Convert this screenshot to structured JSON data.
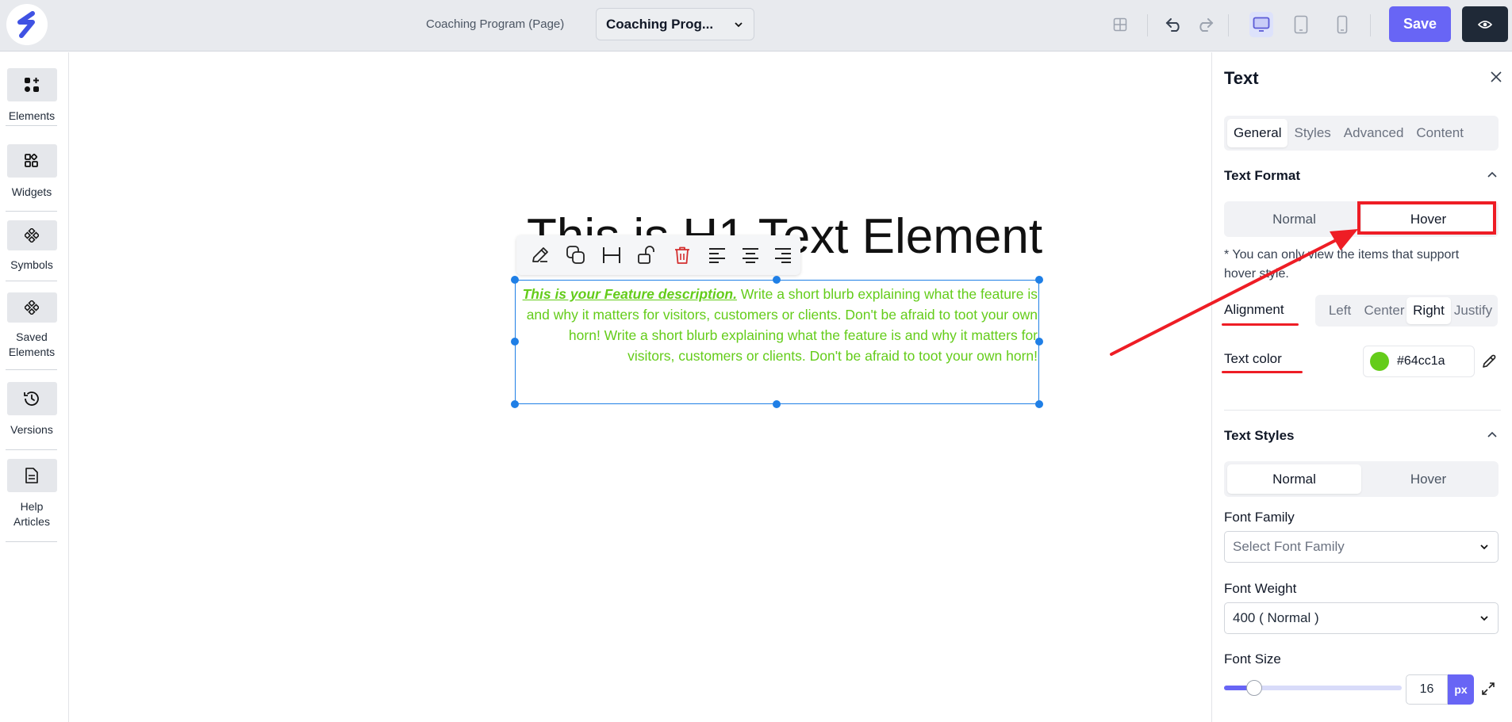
{
  "header": {
    "page_label": "Coaching Program (Page)",
    "page_select_value": "Coaching Prog...",
    "save_label": "Save"
  },
  "sidebar": {
    "items": [
      {
        "label": "Elements",
        "icon": "elements-icon"
      },
      {
        "label": "Widgets",
        "icon": "widgets-icon"
      },
      {
        "label": "Symbols",
        "icon": "symbols-icon"
      },
      {
        "label": "Saved Elements",
        "icon": "saved-elements-icon"
      },
      {
        "label": "Versions",
        "icon": "history-icon"
      },
      {
        "label": "Help Articles",
        "icon": "document-icon"
      }
    ]
  },
  "canvas": {
    "heading": "This is H1 Text Element",
    "paragraph_emphasis": "This is your Feature description.",
    "paragraph_body": " Write a short blurb explaining what the feature is and why it matters for visitors, customers or clients. Don't be afraid to toot your own horn! Write a short blurb explaining what the feature is and why it matters for visitors, customers or clients. Don't be afraid to toot your own horn!"
  },
  "panel": {
    "title": "Text",
    "tabs": [
      "General",
      "Styles",
      "Advanced",
      "Content"
    ],
    "active_tab": "General",
    "text_format": {
      "title": "Text Format",
      "modes": [
        "Normal",
        "Hover"
      ],
      "active_mode": "Hover",
      "note": "* You can only view the items that support hover style.",
      "alignment_label": "Alignment",
      "alignment_options": [
        "Left",
        "Center",
        "Right",
        "Justify"
      ],
      "active_alignment": "Right",
      "text_color_label": "Text color",
      "text_color_value": "#64cc1a"
    },
    "text_styles": {
      "title": "Text Styles",
      "modes": [
        "Normal",
        "Hover"
      ],
      "active_mode": "Normal",
      "font_family_label": "Font Family",
      "font_family_placeholder": "Select Font Family",
      "font_weight_label": "Font Weight",
      "font_weight_value": "400 ( Normal )",
      "font_size_label": "Font Size",
      "font_size_value": "16",
      "font_size_unit": "px",
      "font_size_slider_fraction": 0.17
    }
  },
  "colors": {
    "accent": "#6865f5",
    "text_green": "#64cc1a",
    "selection_blue": "#1f7fe6",
    "annotation_red": "#ee1d25"
  }
}
